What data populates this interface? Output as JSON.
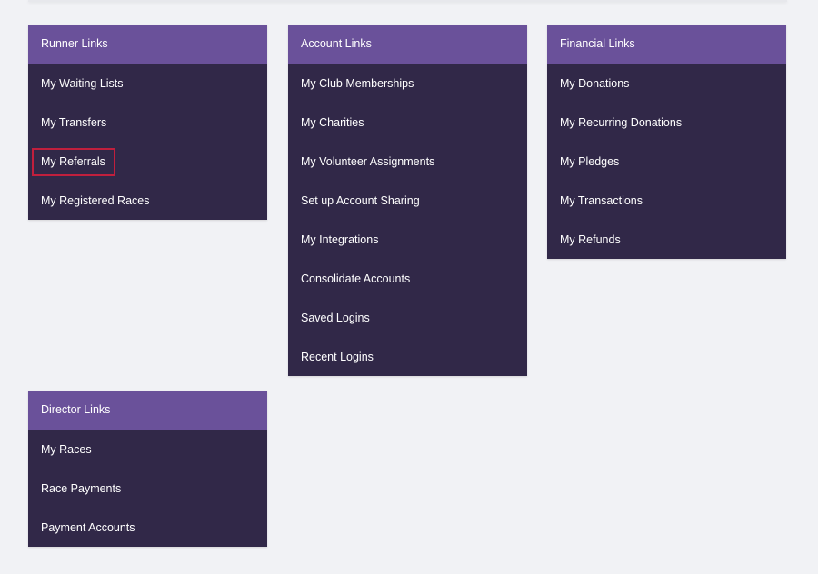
{
  "panels": {
    "runner": {
      "title": "Runner Links",
      "items": [
        {
          "label": "My Waiting Lists"
        },
        {
          "label": "My Transfers"
        },
        {
          "label": "My Referrals"
        },
        {
          "label": "My Registered Races"
        }
      ]
    },
    "account": {
      "title": "Account Links",
      "items": [
        {
          "label": "My Club Memberships"
        },
        {
          "label": "My Charities"
        },
        {
          "label": "My Volunteer Assignments"
        },
        {
          "label": "Set up Account Sharing"
        },
        {
          "label": "My Integrations"
        },
        {
          "label": "Consolidate Accounts"
        },
        {
          "label": "Saved Logins"
        },
        {
          "label": "Recent Logins"
        }
      ]
    },
    "financial": {
      "title": "Financial Links",
      "items": [
        {
          "label": "My Donations"
        },
        {
          "label": "My Recurring Donations"
        },
        {
          "label": "My Pledges"
        },
        {
          "label": "My Transactions"
        },
        {
          "label": "My Refunds"
        }
      ]
    },
    "director": {
      "title": "Director Links",
      "items": [
        {
          "label": "My Races"
        },
        {
          "label": "Race Payments"
        },
        {
          "label": "Payment Accounts"
        }
      ]
    }
  },
  "theme": {
    "background": "#f1f2f5",
    "header": "#6a519a",
    "panel": "#312848",
    "highlight": "#c01f3d"
  }
}
